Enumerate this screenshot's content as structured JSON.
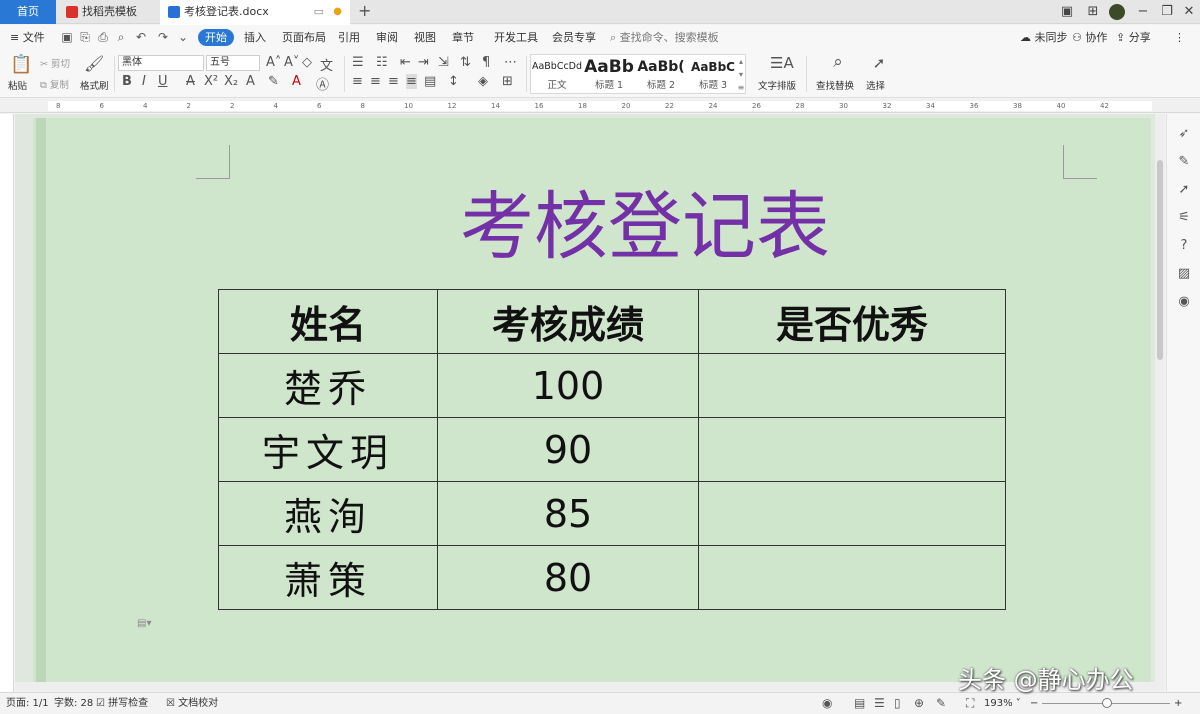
{
  "tabs": {
    "home": "首页",
    "template": "找稻壳模板",
    "document": "考核登记表.docx"
  },
  "menubar": {
    "file": "文件",
    "items": [
      "开始",
      "插入",
      "页面布局",
      "引用",
      "审阅",
      "视图",
      "章节",
      "开发工具",
      "会员专享"
    ],
    "search_placeholder": "查找命令、搜索模板",
    "sync": "未同步",
    "collab": "协作",
    "share": "分享"
  },
  "ribbon": {
    "paste": "粘贴",
    "cut": "剪切",
    "copy": "复制",
    "format_painter": "格式刷",
    "font_name": "黑体",
    "font_size": "五号",
    "styles": [
      {
        "preview": "AaBbCcDd",
        "name": "正文"
      },
      {
        "preview": "AaBb",
        "name": "标题 1"
      },
      {
        "preview": "AaBb(",
        "name": "标题 2"
      },
      {
        "preview": "AaBbC",
        "name": "标题 3"
      }
    ],
    "text_layout": "文字排版",
    "find_replace": "查找替换",
    "select": "选择"
  },
  "ruler_numbers": [
    "8",
    "6",
    "4",
    "2",
    "2",
    "4",
    "6",
    "8",
    "10",
    "12",
    "14",
    "16",
    "18",
    "20",
    "22",
    "24",
    "26",
    "28",
    "30",
    "32",
    "34",
    "36",
    "38",
    "40",
    "42"
  ],
  "document": {
    "title": "考核登记表",
    "title_color": "#7430a7",
    "page_color": "#cfe6cc",
    "table": {
      "headers": [
        "姓名",
        "考核成绩",
        "是否优秀"
      ],
      "rows": [
        {
          "name": "楚乔",
          "score": "100",
          "excellent": ""
        },
        {
          "name": "宇文玥",
          "score": "90",
          "excellent": ""
        },
        {
          "name": "燕洵",
          "score": "85",
          "excellent": ""
        },
        {
          "name": "萧策",
          "score": "80",
          "excellent": ""
        }
      ]
    }
  },
  "statusbar": {
    "page": "页面: 1/1",
    "words": "字数: 28",
    "spell": "拼写检查",
    "proof": "文档校对",
    "zoom": "193%"
  },
  "watermark": "头条 @静心办公"
}
